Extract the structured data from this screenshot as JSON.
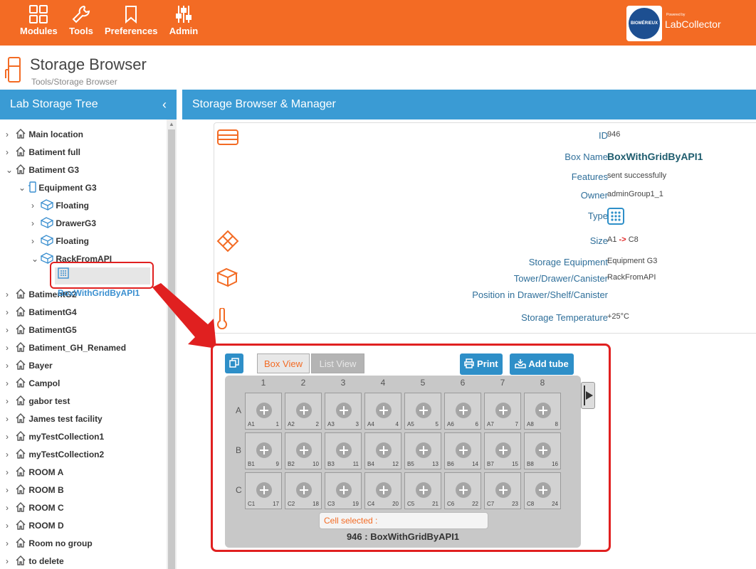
{
  "topbar": {
    "nav": [
      {
        "label": "Modules",
        "icon": "grid-icon"
      },
      {
        "label": "Tools",
        "icon": "wrench-icon"
      },
      {
        "label": "Preferences",
        "icon": "bookmark-icon"
      },
      {
        "label": "Admin",
        "icon": "sliders-icon"
      }
    ],
    "brand_logo_text": "BIOMÉRIEUX",
    "powered_by": "Powered by",
    "product": "LabCollector"
  },
  "page": {
    "title": "Storage Browser",
    "breadcrumb": "Tools/Storage Browser"
  },
  "left_panel": {
    "title": "Lab Storage Tree",
    "items": [
      {
        "label": "Main location",
        "expanded": false
      },
      {
        "label": "Batiment full",
        "expanded": false
      },
      {
        "label": "Batiment G3",
        "expanded": true
      },
      {
        "label": "Equipment G3",
        "expanded": true
      },
      {
        "label": "Floating",
        "expanded": false
      },
      {
        "label": "DrawerG3",
        "expanded": false
      },
      {
        "label": "Floating",
        "expanded": false
      },
      {
        "label": "RackFromAPI",
        "expanded": true
      },
      {
        "label": "BoxWithGridByAPI1",
        "selected": true
      },
      {
        "label": "BatimentG2",
        "expanded": false
      },
      {
        "label": "BatimentG4",
        "expanded": false
      },
      {
        "label": "BatimentG5",
        "expanded": false
      },
      {
        "label": "Batiment_GH_Renamed",
        "expanded": false
      },
      {
        "label": "Bayer",
        "expanded": false
      },
      {
        "label": "Campol",
        "expanded": false
      },
      {
        "label": "gabor test",
        "expanded": false
      },
      {
        "label": "James test facility",
        "expanded": false
      },
      {
        "label": "myTestCollection1",
        "expanded": false
      },
      {
        "label": "myTestCollection2",
        "expanded": false
      },
      {
        "label": "ROOM A",
        "expanded": false
      },
      {
        "label": "ROOM B",
        "expanded": false
      },
      {
        "label": "ROOM C",
        "expanded": false
      },
      {
        "label": "ROOM D",
        "expanded": false
      },
      {
        "label": "Room no group",
        "expanded": false
      },
      {
        "label": "to delete",
        "expanded": false
      }
    ]
  },
  "right_panel": {
    "title": "Storage Browser & Manager",
    "info": {
      "id_label": "ID",
      "id_value": "946",
      "boxname_label": "Box Name",
      "boxname_value": "BoxWithGridByAPI1",
      "features_label": "Features",
      "features_value": "sent successfully",
      "owner_label": "Owner",
      "owner_value": "adminGroup1_1",
      "type_label": "Type",
      "size_label": "Size",
      "size_from": "A1",
      "size_arrow": "->",
      "size_to": "C8",
      "equipment_label": "Storage Equipment",
      "equipment_value": "Equipment G3",
      "tower_label": "Tower/Drawer/Canister",
      "tower_value": "RackFromAPI",
      "position_label": "Position in Drawer/Shelf/Canister",
      "position_value": "",
      "temp_label": "Storage Temperature",
      "temp_value": "+25°C"
    },
    "grid": {
      "tab_box_view": "Box View",
      "tab_list_view": "List View",
      "print_label": "Print",
      "add_tube_label": "Add tube",
      "columns": [
        "1",
        "2",
        "3",
        "4",
        "5",
        "6",
        "7",
        "8"
      ],
      "rows": [
        "A",
        "B",
        "C"
      ],
      "cells": [
        [
          "A1",
          "1"
        ],
        [
          "A2",
          "2"
        ],
        [
          "A3",
          "3"
        ],
        [
          "A4",
          "4"
        ],
        [
          "A5",
          "5"
        ],
        [
          "A6",
          "6"
        ],
        [
          "A7",
          "7"
        ],
        [
          "A8",
          "8"
        ],
        [
          "B1",
          "9"
        ],
        [
          "B2",
          "10"
        ],
        [
          "B3",
          "11"
        ],
        [
          "B4",
          "12"
        ],
        [
          "B5",
          "13"
        ],
        [
          "B6",
          "14"
        ],
        [
          "B7",
          "15"
        ],
        [
          "B8",
          "16"
        ],
        [
          "C1",
          "17"
        ],
        [
          "C2",
          "18"
        ],
        [
          "C3",
          "19"
        ],
        [
          "C4",
          "20"
        ],
        [
          "C5",
          "21"
        ],
        [
          "C6",
          "22"
        ],
        [
          "C7",
          "23"
        ],
        [
          "C8",
          "24"
        ]
      ],
      "cell_selected_label": "Cell selected :",
      "caption": "946 : BoxWithGridByAPI1"
    }
  },
  "colors": {
    "orange": "#f36b24",
    "blue": "#3a9bd4",
    "button_blue": "#2e8fc8",
    "highlight_red": "#e02020"
  }
}
